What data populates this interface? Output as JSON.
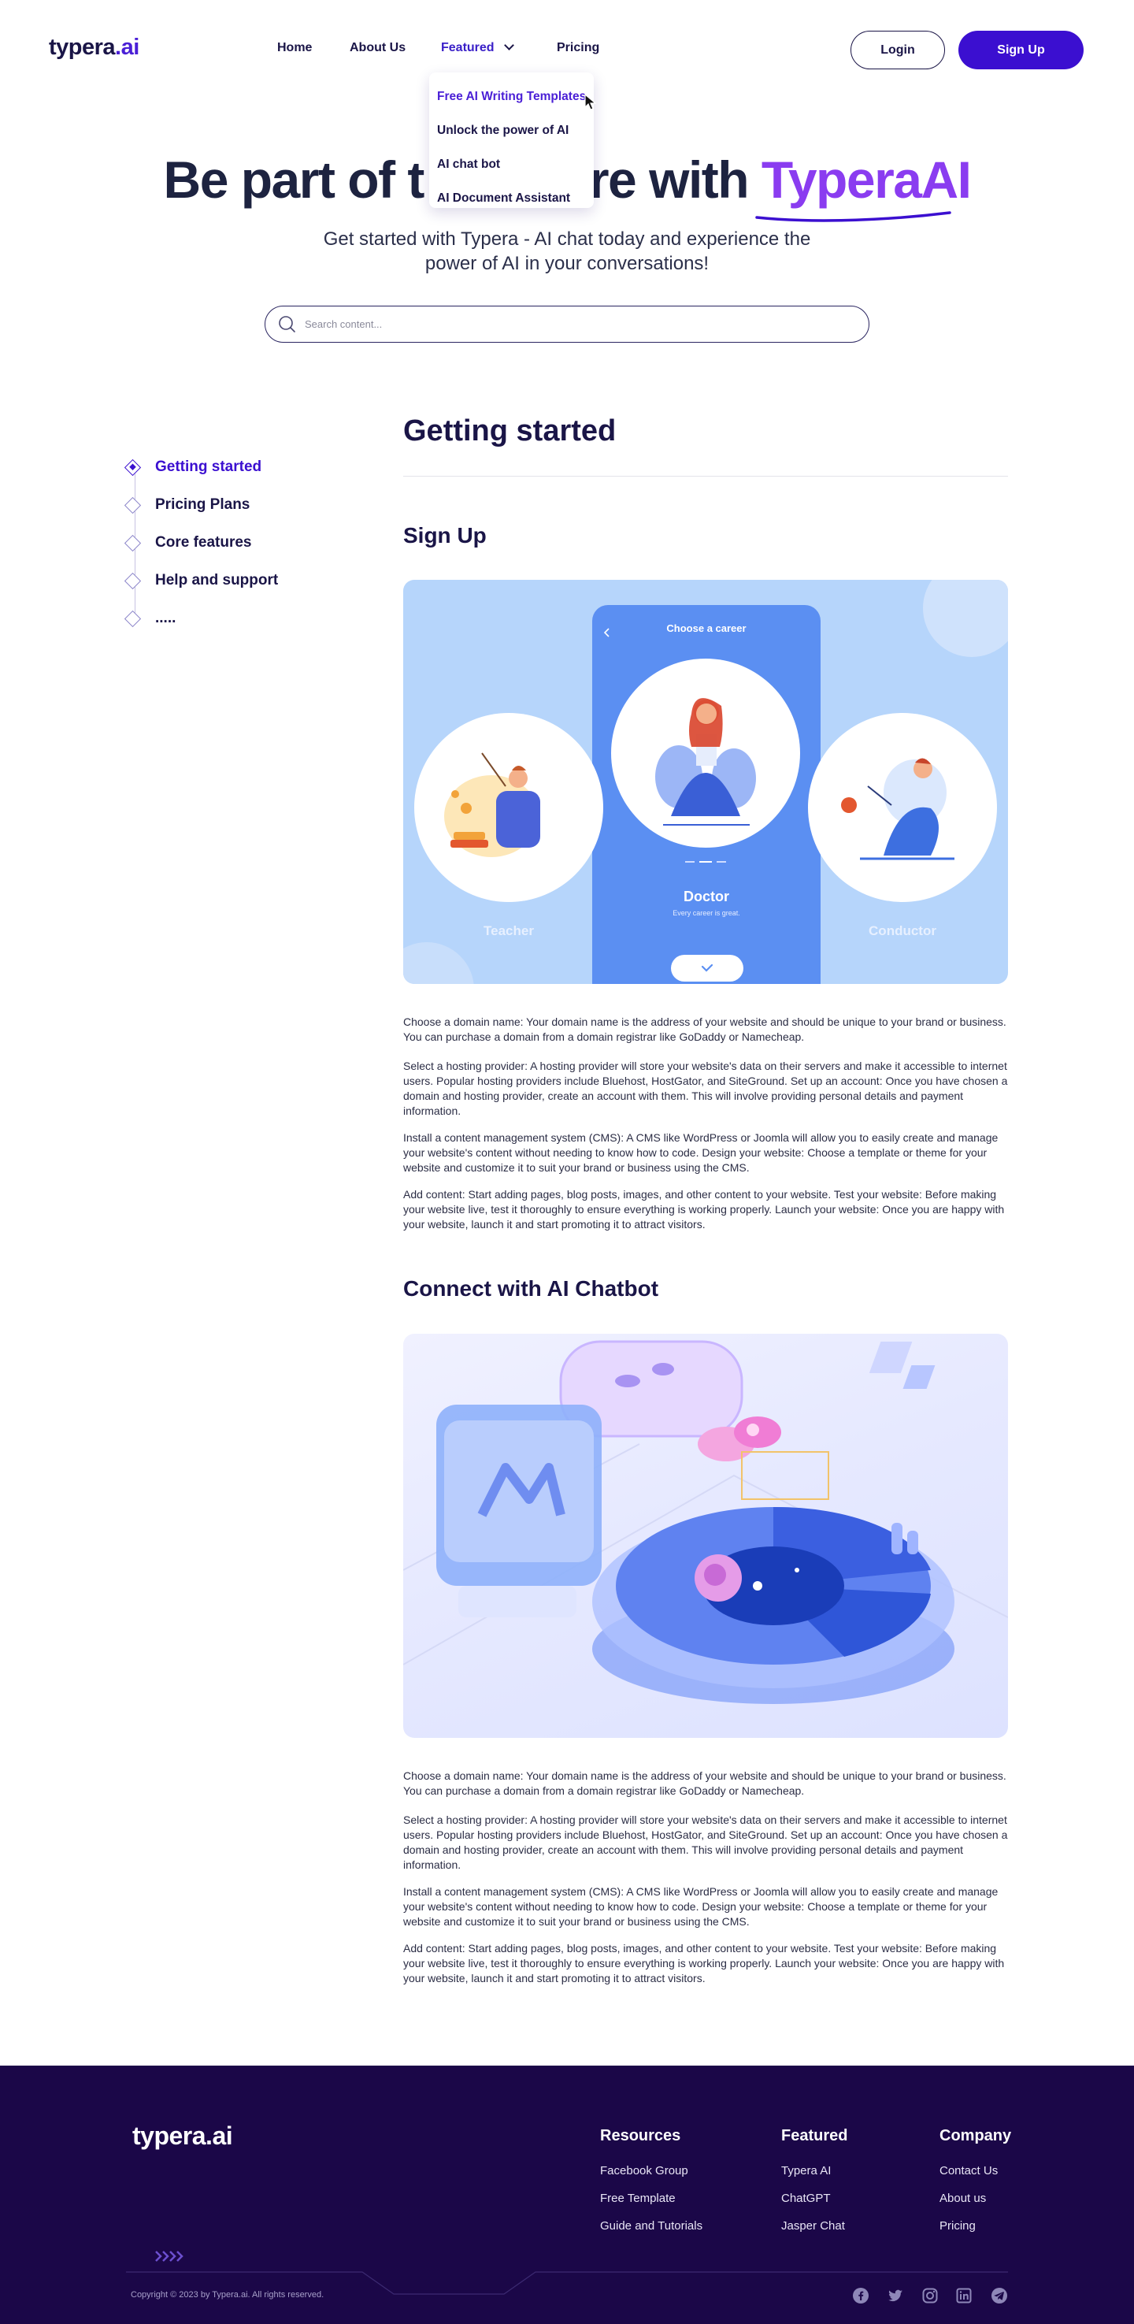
{
  "header": {
    "logo_main": "typera",
    "logo_suffix": ".ai",
    "nav": [
      "Home",
      "About Us",
      "Featured",
      "Pricing"
    ],
    "login_label": "Login",
    "signup_label": "Sign Up"
  },
  "dropdown": {
    "items": [
      "Free AI Writing Templates",
      "Unlock the power of AI",
      "AI chat bot",
      "AI Document Assistant"
    ]
  },
  "hero": {
    "title_part1": "Be part of t",
    "title_part2": "re with ",
    "title_accent": "TyperaAI",
    "subtitle": "Get started with Typera - AI chat today and experience the power of AI in your conversations!",
    "search_placeholder": "Search content..."
  },
  "toc": {
    "items": [
      "Getting started",
      "Pricing Plans",
      "Core features",
      "Help and support",
      "....."
    ]
  },
  "content": {
    "title": "Getting started",
    "section1_title": "Sign Up",
    "section2_title": "Connect with AI Chatbot",
    "career_card": {
      "header": "Choose a career",
      "left_label": "Teacher",
      "center_label": "Doctor",
      "center_sub": "Every career is great.",
      "right_label": "Conductor"
    },
    "paragraphs": [
      "Choose a domain name: Your domain name is the address of your website and should be unique to your brand or business. You can purchase a domain from a domain registrar like GoDaddy or Namecheap.",
      "Select a hosting provider: A hosting provider will store your website's data on their servers and make it accessible to internet users. Popular hosting providers include Bluehost, HostGator, and SiteGround. Set up an account: Once you have chosen a domain and hosting provider, create an account with them. This will involve providing personal details and payment information.",
      "Install a content management system (CMS): A CMS like WordPress or Joomla will allow you to easily create and manage your website's content without needing to know how to code. Design your website: Choose a template or theme for your website and customize it to suit your brand or business using the CMS.",
      "Add content: Start adding pages, blog posts, images, and other content to your website. Test your website: Before making your website live, test it thoroughly to ensure everything is working properly. Launch your website: Once you are happy with your website, launch it and start promoting it to attract visitors."
    ]
  },
  "footer": {
    "logo": "typera.ai",
    "columns": [
      {
        "title": "Resources",
        "links": [
          "Facebook Group",
          "Free Template",
          "Guide and Tutorials"
        ]
      },
      {
        "title": "Featured",
        "links": [
          "Typera AI",
          "ChatGPT",
          "Jasper Chat"
        ]
      },
      {
        "title": "Company",
        "links": [
          "Contact Us",
          "About us",
          "Pricing"
        ]
      }
    ],
    "copyright": "Copyright © 2023 by Typera.ai. All rights reserved.",
    "social_icons": [
      "facebook-icon",
      "twitter-icon",
      "instagram-icon",
      "linkedin-icon",
      "telegram-icon"
    ]
  },
  "colors": {
    "brand": "#3b0fd0",
    "accent": "#8a3cf0",
    "footer_bg": "#1b0748",
    "text_dark": "#1a1547"
  }
}
